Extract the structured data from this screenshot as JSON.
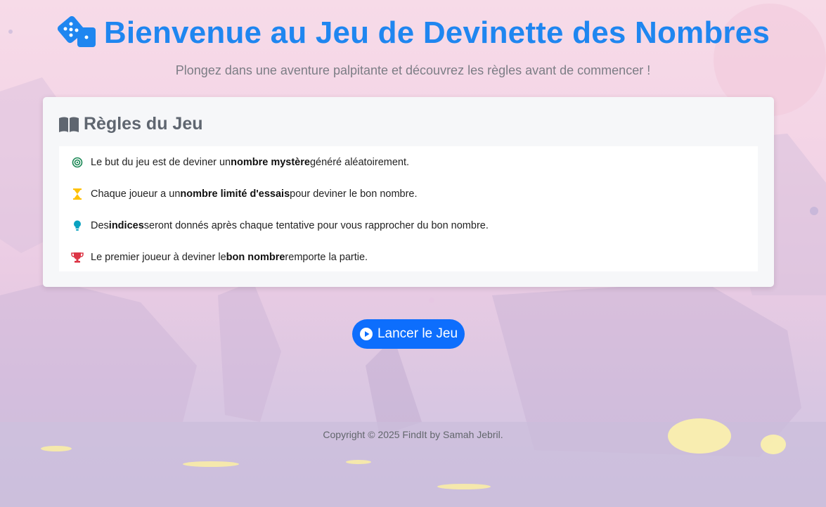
{
  "header": {
    "title": "Bienvenue au Jeu de Devinette des Nombres",
    "subtitle": "Plongez dans une aventure palpitante et découvrez les règles avant de commencer !"
  },
  "rules": {
    "title": "Règles du Jeu",
    "items": [
      {
        "icon": "target-icon",
        "before": "Le but du jeu est de deviner un",
        "bold": "nombre mystère",
        "after": "généré aléatoirement."
      },
      {
        "icon": "hourglass-icon",
        "before": "Chaque joueur a un",
        "bold": "nombre limité d'essais",
        "after": "pour deviner le bon nombre."
      },
      {
        "icon": "lightbulb-icon",
        "before": "Des",
        "bold": "indices",
        "after": "seront donnés après chaque tentative pour vous rapprocher du bon nombre."
      },
      {
        "icon": "trophy-icon",
        "before": "Le premier joueur à deviner le",
        "bold": "bon nombre",
        "after": "remporte la partie."
      }
    ]
  },
  "actions": {
    "launch_label": "Lancer le Jeu"
  },
  "footer": {
    "copyright": "Copyright © 2025 FindIt by Samah Jebril."
  },
  "colors": {
    "title": "#1f86f0",
    "button": "#0d6efd",
    "target": "#198754",
    "hourglass": "#ffc107",
    "lightbulb": "#0aa2c0",
    "trophy": "#dc3545"
  }
}
